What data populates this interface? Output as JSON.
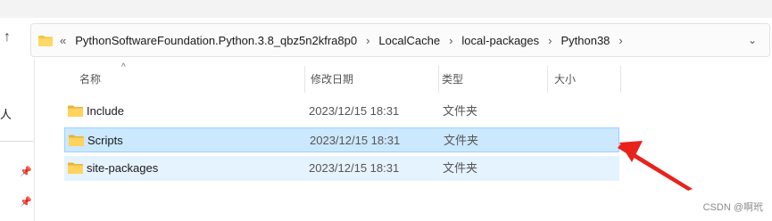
{
  "address": {
    "overflow": "«",
    "crumbs": [
      "PythonSoftwareFoundation.Python.3.8_qbz5n2kfra8p0",
      "LocalCache",
      "local-packages",
      "Python38"
    ],
    "separator": "›",
    "dropdown": "⌄"
  },
  "nav": {
    "up_glyph": "↑"
  },
  "sidebar": {
    "glyph": "人"
  },
  "columns": {
    "name": "名称",
    "date": "修改日期",
    "type": "类型",
    "size": "大小",
    "sort_indicator": "^"
  },
  "rows": [
    {
      "name": "Include",
      "date": "2023/12/15 18:31",
      "type": "文件夹",
      "size": ""
    },
    {
      "name": "Scripts",
      "date": "2023/12/15 18:31",
      "type": "文件夹",
      "size": ""
    },
    {
      "name": "site-packages",
      "date": "2023/12/15 18:31",
      "type": "文件夹",
      "size": ""
    }
  ],
  "watermark": "CSDN @啊玳",
  "colors": {
    "selected_bg": "#cce8ff",
    "hover_bg": "#e5f3ff",
    "folder_yellow": "#f5c443",
    "annotation_red": "#e8231b"
  }
}
